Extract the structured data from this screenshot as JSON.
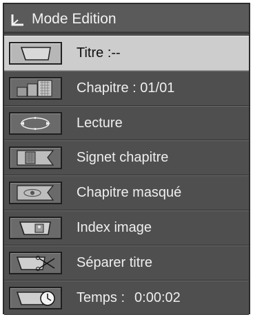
{
  "header": {
    "icon": "l-corner-icon",
    "title": "Mode Edition"
  },
  "menu": {
    "selected_index": 0,
    "items": [
      {
        "icon": "title-folder-icon",
        "label": "Titre :--"
      },
      {
        "icon": "chapter-blocks-icon",
        "label": "Chapitre : 01/01"
      },
      {
        "icon": "play-loop-icon",
        "label": "Lecture"
      },
      {
        "icon": "chapter-marker-icon",
        "label": "Signet chapitre"
      },
      {
        "icon": "hidden-chapter-icon",
        "label": "Chapitre masqué"
      },
      {
        "icon": "index-image-icon",
        "label": "Index image"
      },
      {
        "icon": "split-title-scissors-icon",
        "label": "Séparer titre"
      },
      {
        "icon": "time-clock-icon",
        "label": "Temps :",
        "value": "0:00:02"
      }
    ]
  },
  "colors": {
    "panel": "#4e4e4e",
    "selected_row": "#cdcdcd",
    "text": "#efefef",
    "selected_text": "#111111"
  }
}
